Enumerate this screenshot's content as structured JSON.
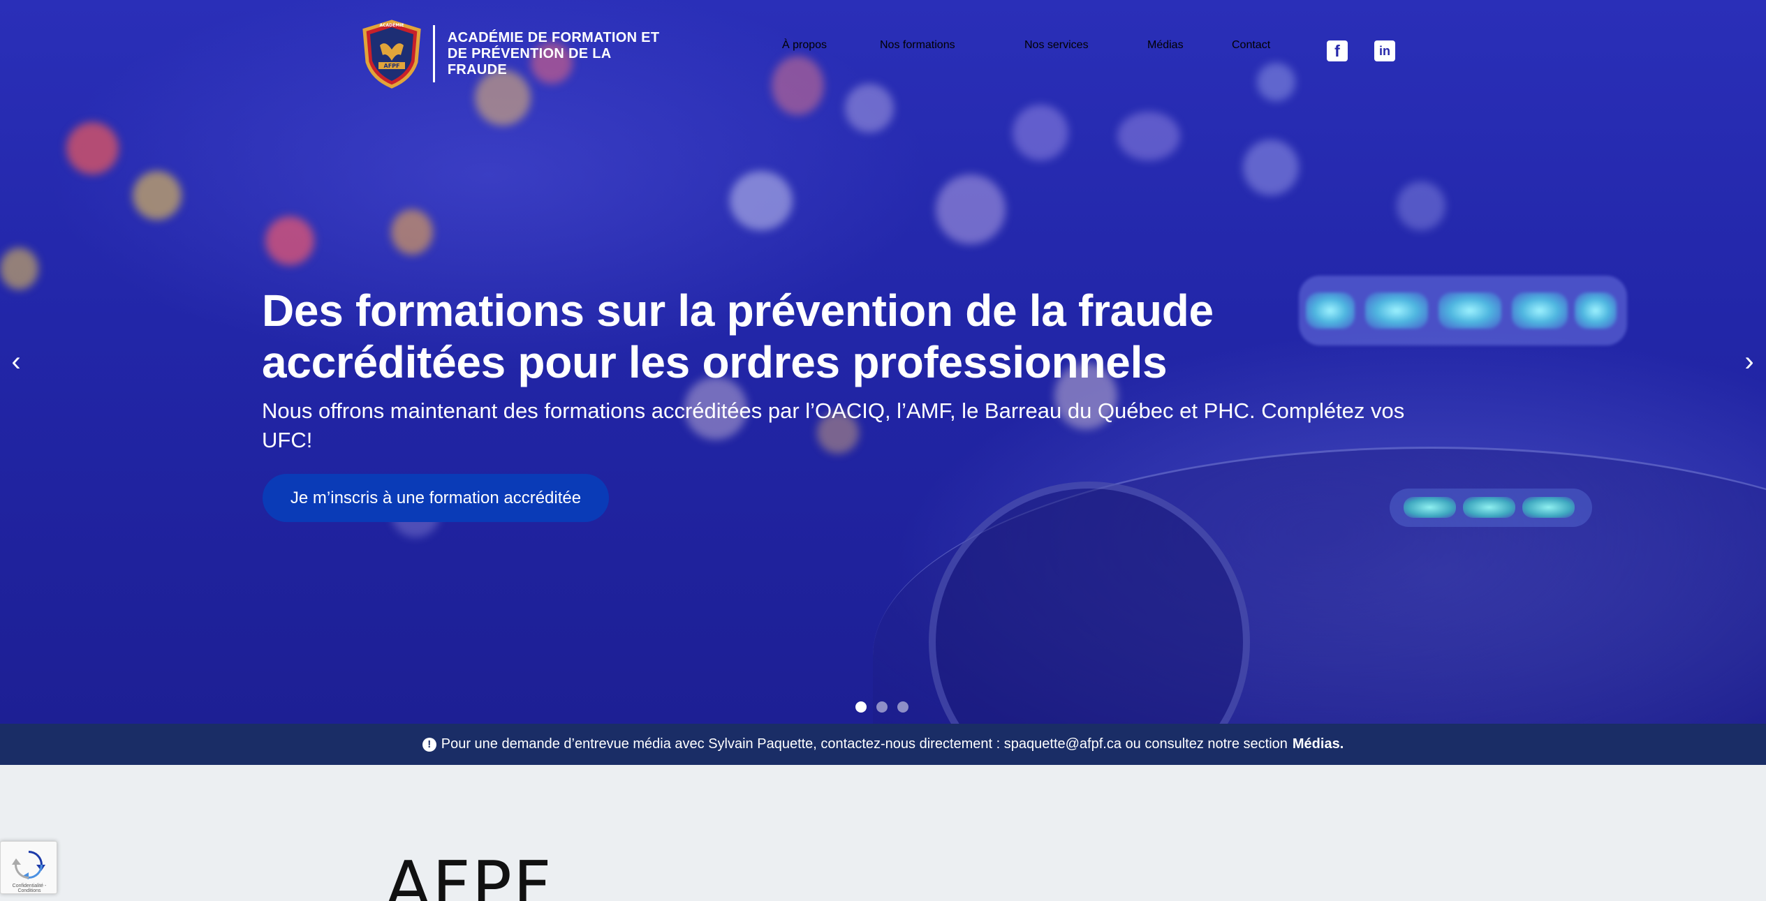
{
  "site": {
    "logo_badge_text": "ACADÉMIE AFPF",
    "logo_line1": "ACADÉMIE DE FORMATION ET",
    "logo_line2": "DE PRÉVENTION DE LA FRAUDE"
  },
  "nav": {
    "items": [
      {
        "label": "À propos"
      },
      {
        "label": "Nos formations"
      },
      {
        "label": "Nos services"
      },
      {
        "label": "Médias"
      },
      {
        "label": "Contact"
      }
    ],
    "social": [
      {
        "icon": "facebook-icon",
        "glyph": "f"
      },
      {
        "icon": "linkedin-icon",
        "glyph": "in"
      }
    ]
  },
  "hero": {
    "title_line1": "Des formations sur la prévention de la fraude",
    "title_line2": "accréditées pour les ordres professionnels",
    "subtitle": "Nous offrons maintenant des formations accréditées par l’OACIQ, l’AMF, le Barreau du Québec et PHC. Complétez vos UFC!",
    "cta_label": "Je m’inscris à une formation accréditée",
    "prev_glyph": "‹",
    "next_glyph": "›",
    "slide_count": 3,
    "active_slide": 1
  },
  "notice": {
    "icon_glyph": "!",
    "text": "Pour une demande d’entrevue média avec Sylvain Paquette, contactez-nous directement : spaquette@afpf.ca ou consultez notre section",
    "link_label": "Médias."
  },
  "section": {
    "heading": "AFPF"
  },
  "recaptcha": {
    "footer_text": "Confidentialité - Conditions"
  },
  "colors": {
    "hero_blue": "#2226a8",
    "cta_blue": "#0a3bb7",
    "notice_bar": "#1a2d66",
    "page_bg": "#eceff2",
    "logo_gold": "#e2a53a",
    "logo_red": "#c8202a"
  }
}
